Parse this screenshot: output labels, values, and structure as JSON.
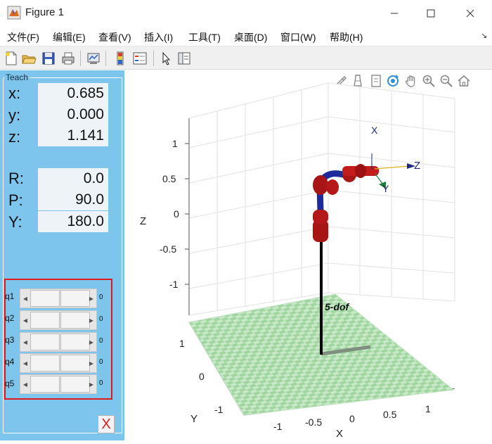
{
  "window": {
    "title": "Figure 1",
    "controls": {
      "minimize": "—",
      "maximize": "☐",
      "close": "✕"
    }
  },
  "menu": {
    "items": [
      "文件(F)",
      "编辑(E)",
      "查看(V)",
      "插入(I)",
      "工具(T)",
      "桌面(D)",
      "窗口(W)",
      "帮助(H)"
    ],
    "overflow": "↘"
  },
  "toolbar": {
    "buttons": [
      "new-figure",
      "open-file",
      "save",
      "print",
      "link-plot",
      "colorbar",
      "legend",
      "edit-plot",
      "property-inspector"
    ]
  },
  "axes_toolbar": {
    "buttons": [
      "brush",
      "data-cursor",
      "export",
      "rotate-3d",
      "pan",
      "zoom-in",
      "zoom-out",
      "restore-view"
    ]
  },
  "teach": {
    "title": "Teach",
    "position": [
      {
        "label": "x:",
        "value": "0.685"
      },
      {
        "label": "y:",
        "value": "0.000"
      },
      {
        "label": "z:",
        "value": "1.141"
      }
    ],
    "orientation": [
      {
        "label": "R:",
        "value": "0.0"
      },
      {
        "label": "P:",
        "value": "90.0"
      },
      {
        "label": "Y:",
        "value": "180.0"
      }
    ],
    "joints": [
      {
        "label": "q1",
        "value": "0"
      },
      {
        "label": "q2",
        "value": "0"
      },
      {
        "label": "q3",
        "value": "0"
      },
      {
        "label": "q4",
        "value": "0"
      },
      {
        "label": "q5",
        "value": "0"
      }
    ],
    "exit_label": "X"
  },
  "plot": {
    "robot_name": "5-dof",
    "axis_labels": {
      "x": "X",
      "y": "Y",
      "z": "Z"
    },
    "z_ticks": [
      "1",
      "0.5",
      "0",
      "-0.5",
      "-1"
    ],
    "y_ticks": [
      "1",
      "0",
      "-1"
    ],
    "x_ticks": [
      "-1",
      "-0.5",
      "0",
      "0.5",
      "1"
    ],
    "frame_labels": {
      "x": "X",
      "y": "Y",
      "z": "Z"
    },
    "colors": {
      "floor_light": "#c8e8c8",
      "floor_dark": "#9fd59f",
      "link": "#1f2a9a",
      "joint": "#b01515",
      "base": "#000000"
    }
  }
}
